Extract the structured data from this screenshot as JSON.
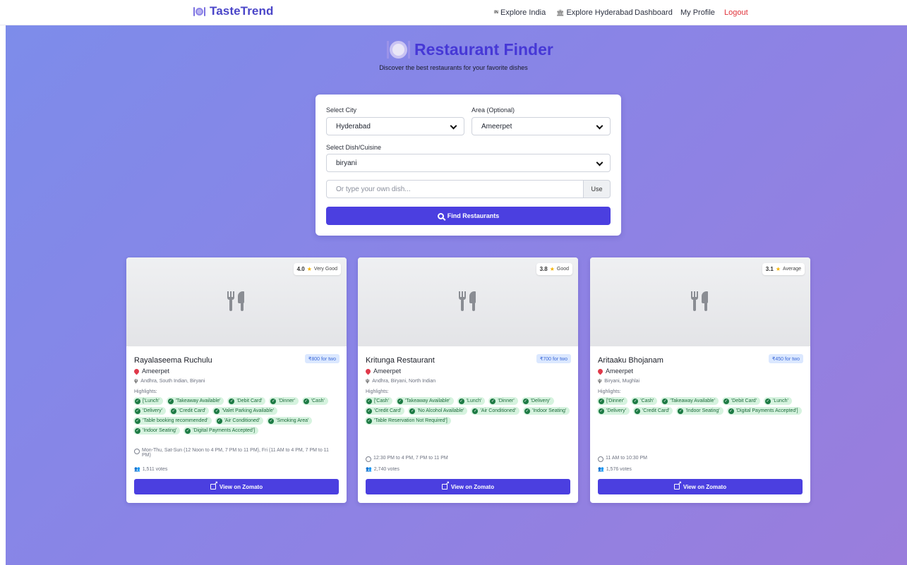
{
  "nav": {
    "brand": "TasteTrend",
    "links": [
      {
        "icon": "IN",
        "label": "Explore India"
      },
      {
        "icon": "building-icon",
        "label": "Explore Hyderabad"
      },
      {
        "label": "Dashboard"
      },
      {
        "label": "My Profile"
      },
      {
        "label": "Logout"
      }
    ]
  },
  "hero": {
    "title": "Restaurant Finder",
    "subtitle": "Discover the best restaurants for your favorite dishes"
  },
  "search": {
    "city_label": "Select City",
    "city_value": "Hyderabad",
    "area_label": "Area (Optional)",
    "area_value": "Ameerpet",
    "dish_label": "Select Dish/Cuisine",
    "dish_value": "biryani",
    "custom_placeholder": "Or type your own dish...",
    "use_label": "Use",
    "find_label": "Find Restaurants"
  },
  "colors": {
    "accent": "#4b3fe0",
    "title": "#4638d6",
    "logout": "#e0323a",
    "tag_bg": "#d6f3df",
    "price_bg": "#dbe8ff"
  },
  "restaurants": [
    {
      "rating": "4.0",
      "rating_text": "Very Good",
      "name": "Rayalaseema Ruchulu",
      "price": "₹800 for two",
      "location": "Ameerpet",
      "cuisines": "Andhra, South Indian, Biryani",
      "highlights_label": "Highlights:",
      "tags": [
        "['Lunch'",
        "'Takeaway Available'",
        "'Debit Card'",
        "'Dinner'",
        "'Cash'",
        "'Delivery'",
        "'Credit Card'",
        "'Valet Parking Available'",
        "'Table booking recommended'",
        "'Air Conditioned'",
        "'Smoking Area'",
        "'Indoor Seating'",
        "'Digital Payments Accepted']"
      ],
      "hours": "Mon-Thu, Sat-Sun (12 Noon to 4 PM, 7 PM to 11 PM), Fri (11 AM to 4 PM, 7 PM to 11 PM)",
      "votes": "1,511 votes",
      "button": "View on Zomato"
    },
    {
      "rating": "3.8",
      "rating_text": "Good",
      "name": "Kritunga Restaurant",
      "price": "₹700 for two",
      "location": "Ameerpet",
      "cuisines": "Andhra, Biryani, North Indian",
      "highlights_label": "Highlights:",
      "tags": [
        "['Cash'",
        "'Takeaway Available'",
        "'Lunch'",
        "'Dinner'",
        "'Delivery'",
        "'Credit Card'",
        "'No Alcohol Available'",
        "'Air Conditioned'",
        "'Indoor Seating'",
        "'Table Reservation Not Required']"
      ],
      "hours": "12:30 PM to 4 PM, 7 PM to 11 PM",
      "votes": "2,740 votes",
      "button": "View on Zomato"
    },
    {
      "rating": "3.1",
      "rating_text": "Average",
      "name": "Aritaaku Bhojanam",
      "price": "₹450 for two",
      "location": "Ameerpet",
      "cuisines": "Biryani, Mughlai",
      "highlights_label": "Highlights:",
      "tags": [
        "['Dinner'",
        "'Cash'",
        "'Takeaway Available'",
        "'Debit Card'",
        "'Lunch'",
        "'Delivery'",
        "'Credit Card'",
        "'Indoor Seating'",
        "'Digital Payments Accepted']"
      ],
      "hours": "11 AM to 10:30 PM",
      "votes": "1,576 votes",
      "button": "View on Zomato"
    }
  ]
}
